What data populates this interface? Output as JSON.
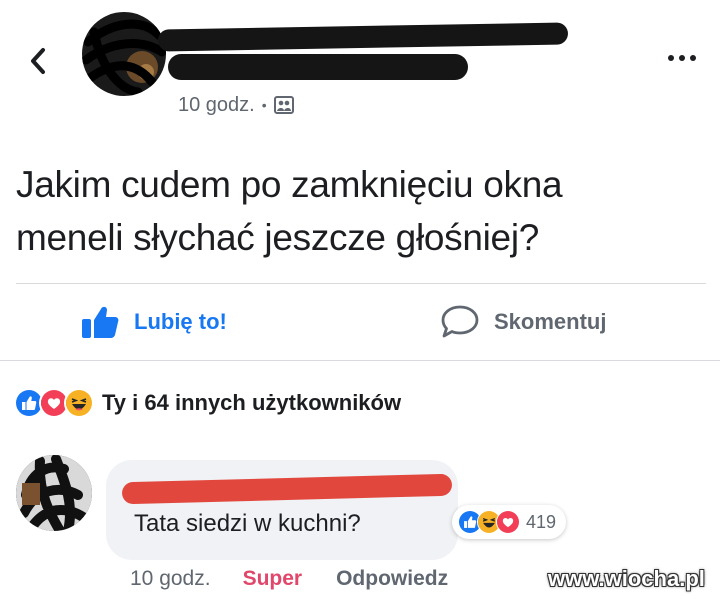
{
  "header": {
    "time": "10 godz.",
    "separator": "•",
    "audience_icon": "friends-icon"
  },
  "post": {
    "text_line1": "Jakim cudem po zamknięciu okna",
    "text_line2": "meneli słychać jeszcze głośniej?"
  },
  "actions": {
    "like_label": "Lubię to!",
    "comment_label": "Skomentuj"
  },
  "reactions": {
    "icons": [
      "like-icon",
      "love-icon",
      "haha-icon"
    ],
    "summary": "Ty i 64 innych użytkowników"
  },
  "comment": {
    "text": "Tata siedzi w kuchni?",
    "reaction_icons": [
      "like-icon",
      "haha-icon",
      "love-icon"
    ],
    "reaction_count": "419",
    "time": "10 godz.",
    "reaction_label": "Super",
    "reply_label": "Odpowiedz"
  },
  "watermark": "www.wiocha.pl",
  "colors": {
    "accent": "#1877f2",
    "love": "#f33e58",
    "super": "#e0476b",
    "haha": "#f7b125",
    "secondary_text": "#606770",
    "bubble": "#f0f2f5"
  }
}
